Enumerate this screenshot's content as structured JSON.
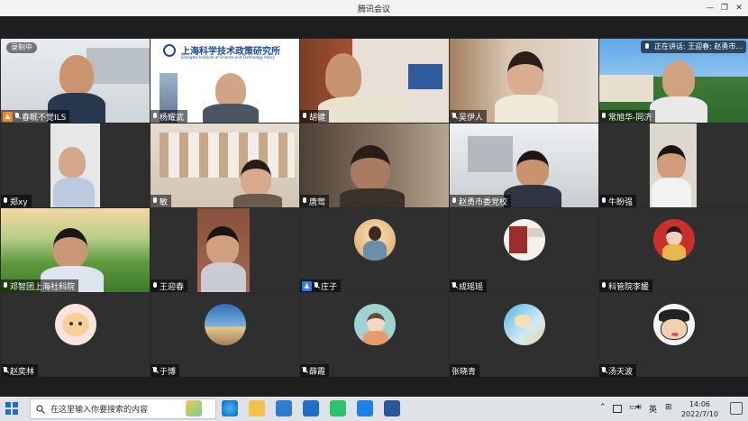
{
  "window": {
    "title": "腾讯会议"
  },
  "recording": {
    "label": "录制中"
  },
  "speaking": {
    "label": "正在讲话: 王迎春; 赵勇市..."
  },
  "participants": [
    {
      "name": "春眠不觉ILS",
      "muted": true,
      "host": true
    },
    {
      "name": "杨耀武",
      "muted": false
    },
    {
      "name": "胡键",
      "muted": false
    },
    {
      "name": "吴伊人",
      "muted": true
    },
    {
      "name": "常旭华-同济",
      "muted": false
    },
    {
      "name": "郑xy",
      "muted": false
    },
    {
      "name": "敏",
      "muted": false
    },
    {
      "name": "唐莺",
      "muted": false
    },
    {
      "name": "赵勇市委党校",
      "muted": false
    },
    {
      "name": "牛盼强",
      "muted": false
    },
    {
      "name": "邓智团上海社科院",
      "muted": false
    },
    {
      "name": "王迎春",
      "muted": false,
      "active": true
    },
    {
      "name": "庄子",
      "muted": true,
      "cohost": true
    },
    {
      "name": "成瑶瑶",
      "muted": true
    },
    {
      "name": "科管院李媛",
      "muted": false
    },
    {
      "name": "赵奕林",
      "muted": true
    },
    {
      "name": "于博",
      "muted": true
    },
    {
      "name": "薛霞",
      "muted": true
    },
    {
      "name": "张晓青",
      "muted": false,
      "noicon": true
    },
    {
      "name": "汤天波",
      "muted": true
    }
  ],
  "banner_text": {
    "cn": "上海科学技术政策研究所",
    "en": "Shanghai Institute of Science and Technology Policy"
  },
  "taskbar": {
    "search_placeholder": "在这里输入你要搜索的内容",
    "ime": "英",
    "time": "14:06",
    "date": "2022/7/10"
  },
  "colors": {
    "active_border": "#2fb36b",
    "host_badge": "#f08a24",
    "cohost_badge": "#2f7de1"
  }
}
